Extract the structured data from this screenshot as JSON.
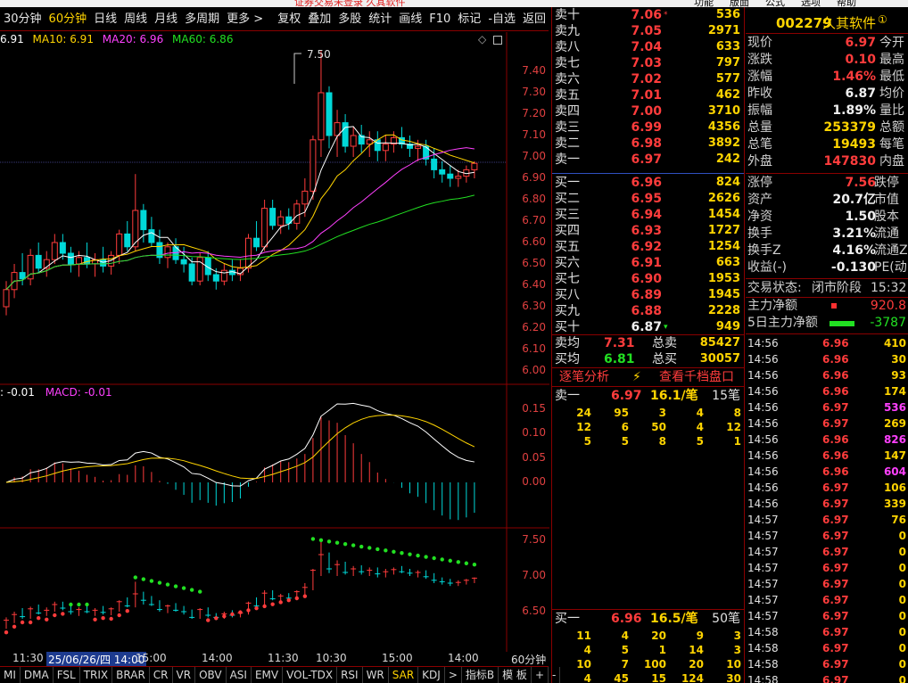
{
  "top_strip": {
    "title": "证券交易未登录 久其软件",
    "menu": [
      "功能",
      "版面",
      "公式",
      "选项",
      "帮助"
    ]
  },
  "toolbar": {
    "left_items": [
      "30分钟",
      "60分钟",
      "日线",
      "周线",
      "月线",
      "多周期",
      "更多 >"
    ],
    "active": "60分钟",
    "right_items": [
      "复权",
      "叠加",
      "多股",
      "统计",
      "画线",
      "F10",
      "标记",
      "-自选",
      "返回"
    ]
  },
  "main_legend": {
    "ma5": "6.91",
    "ma10_label": "MA10: 6.91",
    "ma20_label": "MA20: 6.96",
    "ma60_label": "MA60: 6.86",
    "colors": {
      "ma5": "#ffffff",
      "ma10": "#ffd400",
      "ma20": "#ff40ff",
      "ma60": "#22e022"
    }
  },
  "peak_label": "7.50",
  "price_axis": [
    "7.40",
    "7.30",
    "7.20",
    "7.10",
    "7.00",
    "6.90",
    "6.80",
    "6.70",
    "6.60",
    "6.50",
    "6.40",
    "6.30",
    "6.20",
    "6.10",
    "6.00"
  ],
  "macd_legend": {
    "dif": ": -0.01",
    "macd": "MACD: -0.01"
  },
  "macd_axis": [
    "0.15",
    "0.10",
    "0.05",
    "0.00"
  ],
  "sar_axis": [
    "7.50",
    "7.00",
    "6.50"
  ],
  "time_axis": [
    "11:30",
    "25/06/26/四 14:00",
    "15:00",
    "14:00",
    "11:30",
    "10:30",
    "15:00",
    "14:00"
  ],
  "period_label": "60分钟",
  "bottom_tabs": [
    "MI",
    "DMA",
    "FSL",
    "TRIX",
    "BRAR",
    "CR",
    "VR",
    "OBV",
    "ASI",
    "EMV",
    "VOL-TDX",
    "RSI",
    "WR",
    "SAR",
    "KDJ",
    ">",
    "指标B",
    "模 板",
    "+",
    "-"
  ],
  "bottom_active": "SAR",
  "chart_data": {
    "type": "candlestick",
    "title": "",
    "ylim": [
      5.95,
      7.55
    ],
    "ma": [
      "MA5",
      "MA10",
      "MA20",
      "MA60"
    ],
    "candles": [
      [
        6.3,
        6.42,
        6.26,
        6.38
      ],
      [
        6.38,
        6.5,
        6.34,
        6.46
      ],
      [
        6.46,
        6.55,
        6.4,
        6.43
      ],
      [
        6.43,
        6.57,
        6.4,
        6.54
      ],
      [
        6.54,
        6.6,
        6.46,
        6.48
      ],
      [
        6.48,
        6.56,
        6.44,
        6.52
      ],
      [
        6.52,
        6.64,
        6.5,
        6.6
      ],
      [
        6.6,
        6.64,
        6.52,
        6.55
      ],
      [
        6.55,
        6.58,
        6.46,
        6.5
      ],
      [
        6.5,
        6.56,
        6.44,
        6.53
      ],
      [
        6.53,
        6.6,
        6.48,
        6.5
      ],
      [
        6.5,
        6.55,
        6.44,
        6.52
      ],
      [
        6.52,
        6.58,
        6.46,
        6.49
      ],
      [
        6.49,
        6.56,
        6.45,
        6.54
      ],
      [
        6.54,
        6.66,
        6.5,
        6.64
      ],
      [
        6.64,
        6.7,
        6.56,
        6.58
      ],
      [
        6.58,
        6.92,
        6.56,
        6.75
      ],
      [
        6.75,
        6.78,
        6.6,
        6.66
      ],
      [
        6.66,
        6.72,
        6.58,
        6.6
      ],
      [
        6.6,
        6.66,
        6.5,
        6.53
      ],
      [
        6.53,
        6.6,
        6.48,
        6.58
      ],
      [
        6.58,
        6.62,
        6.5,
        6.52
      ],
      [
        6.52,
        6.58,
        6.46,
        6.5
      ],
      [
        6.5,
        6.53,
        6.4,
        6.42
      ],
      [
        6.42,
        6.55,
        6.4,
        6.53
      ],
      [
        6.53,
        6.56,
        6.42,
        6.45
      ],
      [
        6.45,
        6.48,
        6.38,
        6.42
      ],
      [
        6.42,
        6.5,
        6.4,
        6.47
      ],
      [
        6.47,
        6.52,
        6.42,
        6.45
      ],
      [
        6.45,
        6.52,
        6.42,
        6.48
      ],
      [
        6.48,
        6.64,
        6.46,
        6.62
      ],
      [
        6.62,
        6.7,
        6.56,
        6.58
      ],
      [
        6.58,
        6.8,
        6.56,
        6.76
      ],
      [
        6.76,
        6.8,
        6.66,
        6.68
      ],
      [
        6.68,
        6.75,
        6.64,
        6.72
      ],
      [
        6.72,
        6.76,
        6.66,
        6.69
      ],
      [
        6.69,
        6.8,
        6.66,
        6.78
      ],
      [
        6.78,
        6.9,
        6.72,
        6.84
      ],
      [
        6.84,
        7.1,
        6.8,
        7.08
      ],
      [
        7.08,
        7.5,
        7.0,
        7.3
      ],
      [
        7.3,
        7.33,
        7.04,
        7.1
      ],
      [
        7.1,
        7.22,
        7.0,
        7.16
      ],
      [
        7.16,
        7.2,
        7.02,
        7.05
      ],
      [
        7.05,
        7.14,
        7.0,
        7.1
      ],
      [
        7.1,
        7.15,
        7.02,
        7.06
      ],
      [
        7.06,
        7.12,
        7.0,
        7.08
      ],
      [
        7.08,
        7.12,
        6.98,
        7.03
      ],
      [
        7.03,
        7.1,
        6.98,
        7.06
      ],
      [
        7.06,
        7.12,
        7.02,
        7.09
      ],
      [
        7.09,
        7.14,
        7.04,
        7.06
      ],
      [
        7.06,
        7.1,
        7.0,
        7.04
      ],
      [
        7.04,
        7.08,
        6.98,
        7.05
      ],
      [
        7.05,
        7.08,
        6.96,
        6.99
      ],
      [
        6.99,
        7.04,
        6.9,
        6.94
      ],
      [
        6.94,
        6.98,
        6.88,
        6.92
      ],
      [
        6.92,
        6.96,
        6.86,
        6.9
      ],
      [
        6.9,
        6.94,
        6.86,
        6.91
      ],
      [
        6.91,
        6.96,
        6.88,
        6.94
      ],
      [
        6.94,
        6.98,
        6.9,
        6.97
      ]
    ]
  },
  "orderbook": {
    "asks": [
      {
        "label": "卖十",
        "price": "7.06",
        "vol": "536",
        "mark": "*"
      },
      {
        "label": "卖九",
        "price": "7.05",
        "vol": "2971"
      },
      {
        "label": "卖八",
        "price": "7.04",
        "vol": "633"
      },
      {
        "label": "卖七",
        "price": "7.03",
        "vol": "797"
      },
      {
        "label": "卖六",
        "price": "7.02",
        "vol": "577"
      },
      {
        "label": "卖五",
        "price": "7.01",
        "vol": "462"
      },
      {
        "label": "卖四",
        "price": "7.00",
        "vol": "3710"
      },
      {
        "label": "卖三",
        "price": "6.99",
        "vol": "4356"
      },
      {
        "label": "卖二",
        "price": "6.98",
        "vol": "3892"
      },
      {
        "label": "卖一",
        "price": "6.97",
        "vol": "242"
      }
    ],
    "bids": [
      {
        "label": "买一",
        "price": "6.96",
        "vol": "824"
      },
      {
        "label": "买二",
        "price": "6.95",
        "vol": "2626"
      },
      {
        "label": "买三",
        "price": "6.94",
        "vol": "1454"
      },
      {
        "label": "买四",
        "price": "6.93",
        "vol": "1727"
      },
      {
        "label": "买五",
        "price": "6.92",
        "vol": "1254"
      },
      {
        "label": "买六",
        "price": "6.91",
        "vol": "663"
      },
      {
        "label": "买七",
        "price": "6.90",
        "vol": "1953"
      },
      {
        "label": "买八",
        "price": "6.89",
        "vol": "1945"
      },
      {
        "label": "买九",
        "price": "6.88",
        "vol": "2228"
      },
      {
        "label": "买十",
        "price": "6.87",
        "vol": "949",
        "mark": "▾"
      }
    ],
    "avg": [
      {
        "label": "卖均",
        "price": "7.31",
        "label2": "总卖",
        "vol": "85427"
      },
      {
        "label": "买均",
        "price": "6.81",
        "label2": "总买",
        "vol": "30057"
      }
    ],
    "buttons": {
      "tick": "逐笔分析",
      "bolt": "⚡",
      "thousand": "查看千档盘口"
    },
    "sell1_queue": {
      "label": "卖一",
      "price": "6.97",
      "per": "16.1/笔",
      "count": "15笔",
      "rows": [
        [
          "24",
          "95",
          "3",
          "4",
          "8"
        ],
        [
          "12",
          "6",
          "50",
          "4",
          "12"
        ],
        [
          "5",
          "5",
          "8",
          "5",
          "1"
        ]
      ]
    },
    "buy1_queue": {
      "label": "买一",
      "price": "6.96",
      "per": "16.5/笔",
      "count": "50笔",
      "rows": [
        [
          "11",
          "4",
          "20",
          "9",
          "3"
        ],
        [
          "4",
          "5",
          "1",
          "14",
          "3"
        ],
        [
          "10",
          "7",
          "100",
          "20",
          "10"
        ],
        [
          "4",
          "45",
          "15",
          "124",
          "30"
        ]
      ]
    }
  },
  "quote": {
    "code": "002279",
    "name": "久其软件",
    "badge": "①",
    "rows": [
      [
        "现价",
        "6.97",
        "今开",
        "red"
      ],
      [
        "涨跌",
        "0.10",
        "最高",
        "red"
      ],
      [
        "涨幅",
        "1.46%",
        "最低",
        "red"
      ],
      [
        "昨收",
        "6.87",
        "均价",
        "white"
      ],
      [
        "振幅",
        "1.89%",
        "量比",
        "white"
      ],
      [
        "总量",
        "253379",
        "总额",
        "yellow"
      ],
      [
        "总笔",
        "19493",
        "每笔",
        "yellow"
      ],
      [
        "外盘",
        "147830",
        "内盘",
        "red"
      ]
    ],
    "rows2": [
      [
        "涨停",
        "7.56",
        "跌停",
        "red"
      ],
      [
        "资产",
        "20.7亿",
        "市值",
        "white"
      ],
      [
        "净资",
        "1.50",
        "股本",
        "white"
      ],
      [
        "换手",
        "3.21%",
        "流通",
        "white"
      ],
      [
        "换手Z",
        "4.16%",
        "流通Z",
        "white"
      ],
      [
        "收益(-)",
        "-0.130",
        "PE(动)",
        "white"
      ]
    ],
    "status_label": "交易状态:",
    "status_value": "闭市阶段",
    "status_time": "15:32:",
    "main_flow": {
      "label": "主力净额",
      "value": "920.8"
    },
    "five_day": {
      "label": "5日主力净额",
      "value": "-3787"
    },
    "trades": [
      [
        "14:56",
        "6.96",
        "410",
        "yellow"
      ],
      [
        "14:56",
        "6.96",
        "30",
        "yellow"
      ],
      [
        "14:56",
        "6.96",
        "93",
        "yellow"
      ],
      [
        "14:56",
        "6.96",
        "174",
        "yellow"
      ],
      [
        "14:56",
        "6.97",
        "536",
        "magenta"
      ],
      [
        "14:56",
        "6.97",
        "269",
        "yellow"
      ],
      [
        "14:56",
        "6.96",
        "826",
        "magenta"
      ],
      [
        "14:56",
        "6.96",
        "147",
        "yellow"
      ],
      [
        "14:56",
        "6.96",
        "604",
        "magenta"
      ],
      [
        "14:56",
        "6.97",
        "106",
        "yellow"
      ],
      [
        "14:56",
        "6.97",
        "339",
        "yellow"
      ],
      [
        "14:57",
        "6.97",
        "76",
        "yellow"
      ],
      [
        "14:57",
        "6.97",
        "0",
        "yellow"
      ],
      [
        "14:57",
        "6.97",
        "0",
        "yellow"
      ],
      [
        "14:57",
        "6.97",
        "0",
        "yellow"
      ],
      [
        "14:57",
        "6.97",
        "0",
        "yellow"
      ],
      [
        "14:57",
        "6.97",
        "0",
        "yellow"
      ],
      [
        "14:57",
        "6.97",
        "0",
        "yellow"
      ],
      [
        "14:58",
        "6.97",
        "0",
        "yellow"
      ],
      [
        "14:58",
        "6.97",
        "0",
        "yellow"
      ],
      [
        "14:58",
        "6.97",
        "0",
        "yellow"
      ],
      [
        "14:58",
        "6.97",
        "0",
        "yellow"
      ]
    ]
  }
}
